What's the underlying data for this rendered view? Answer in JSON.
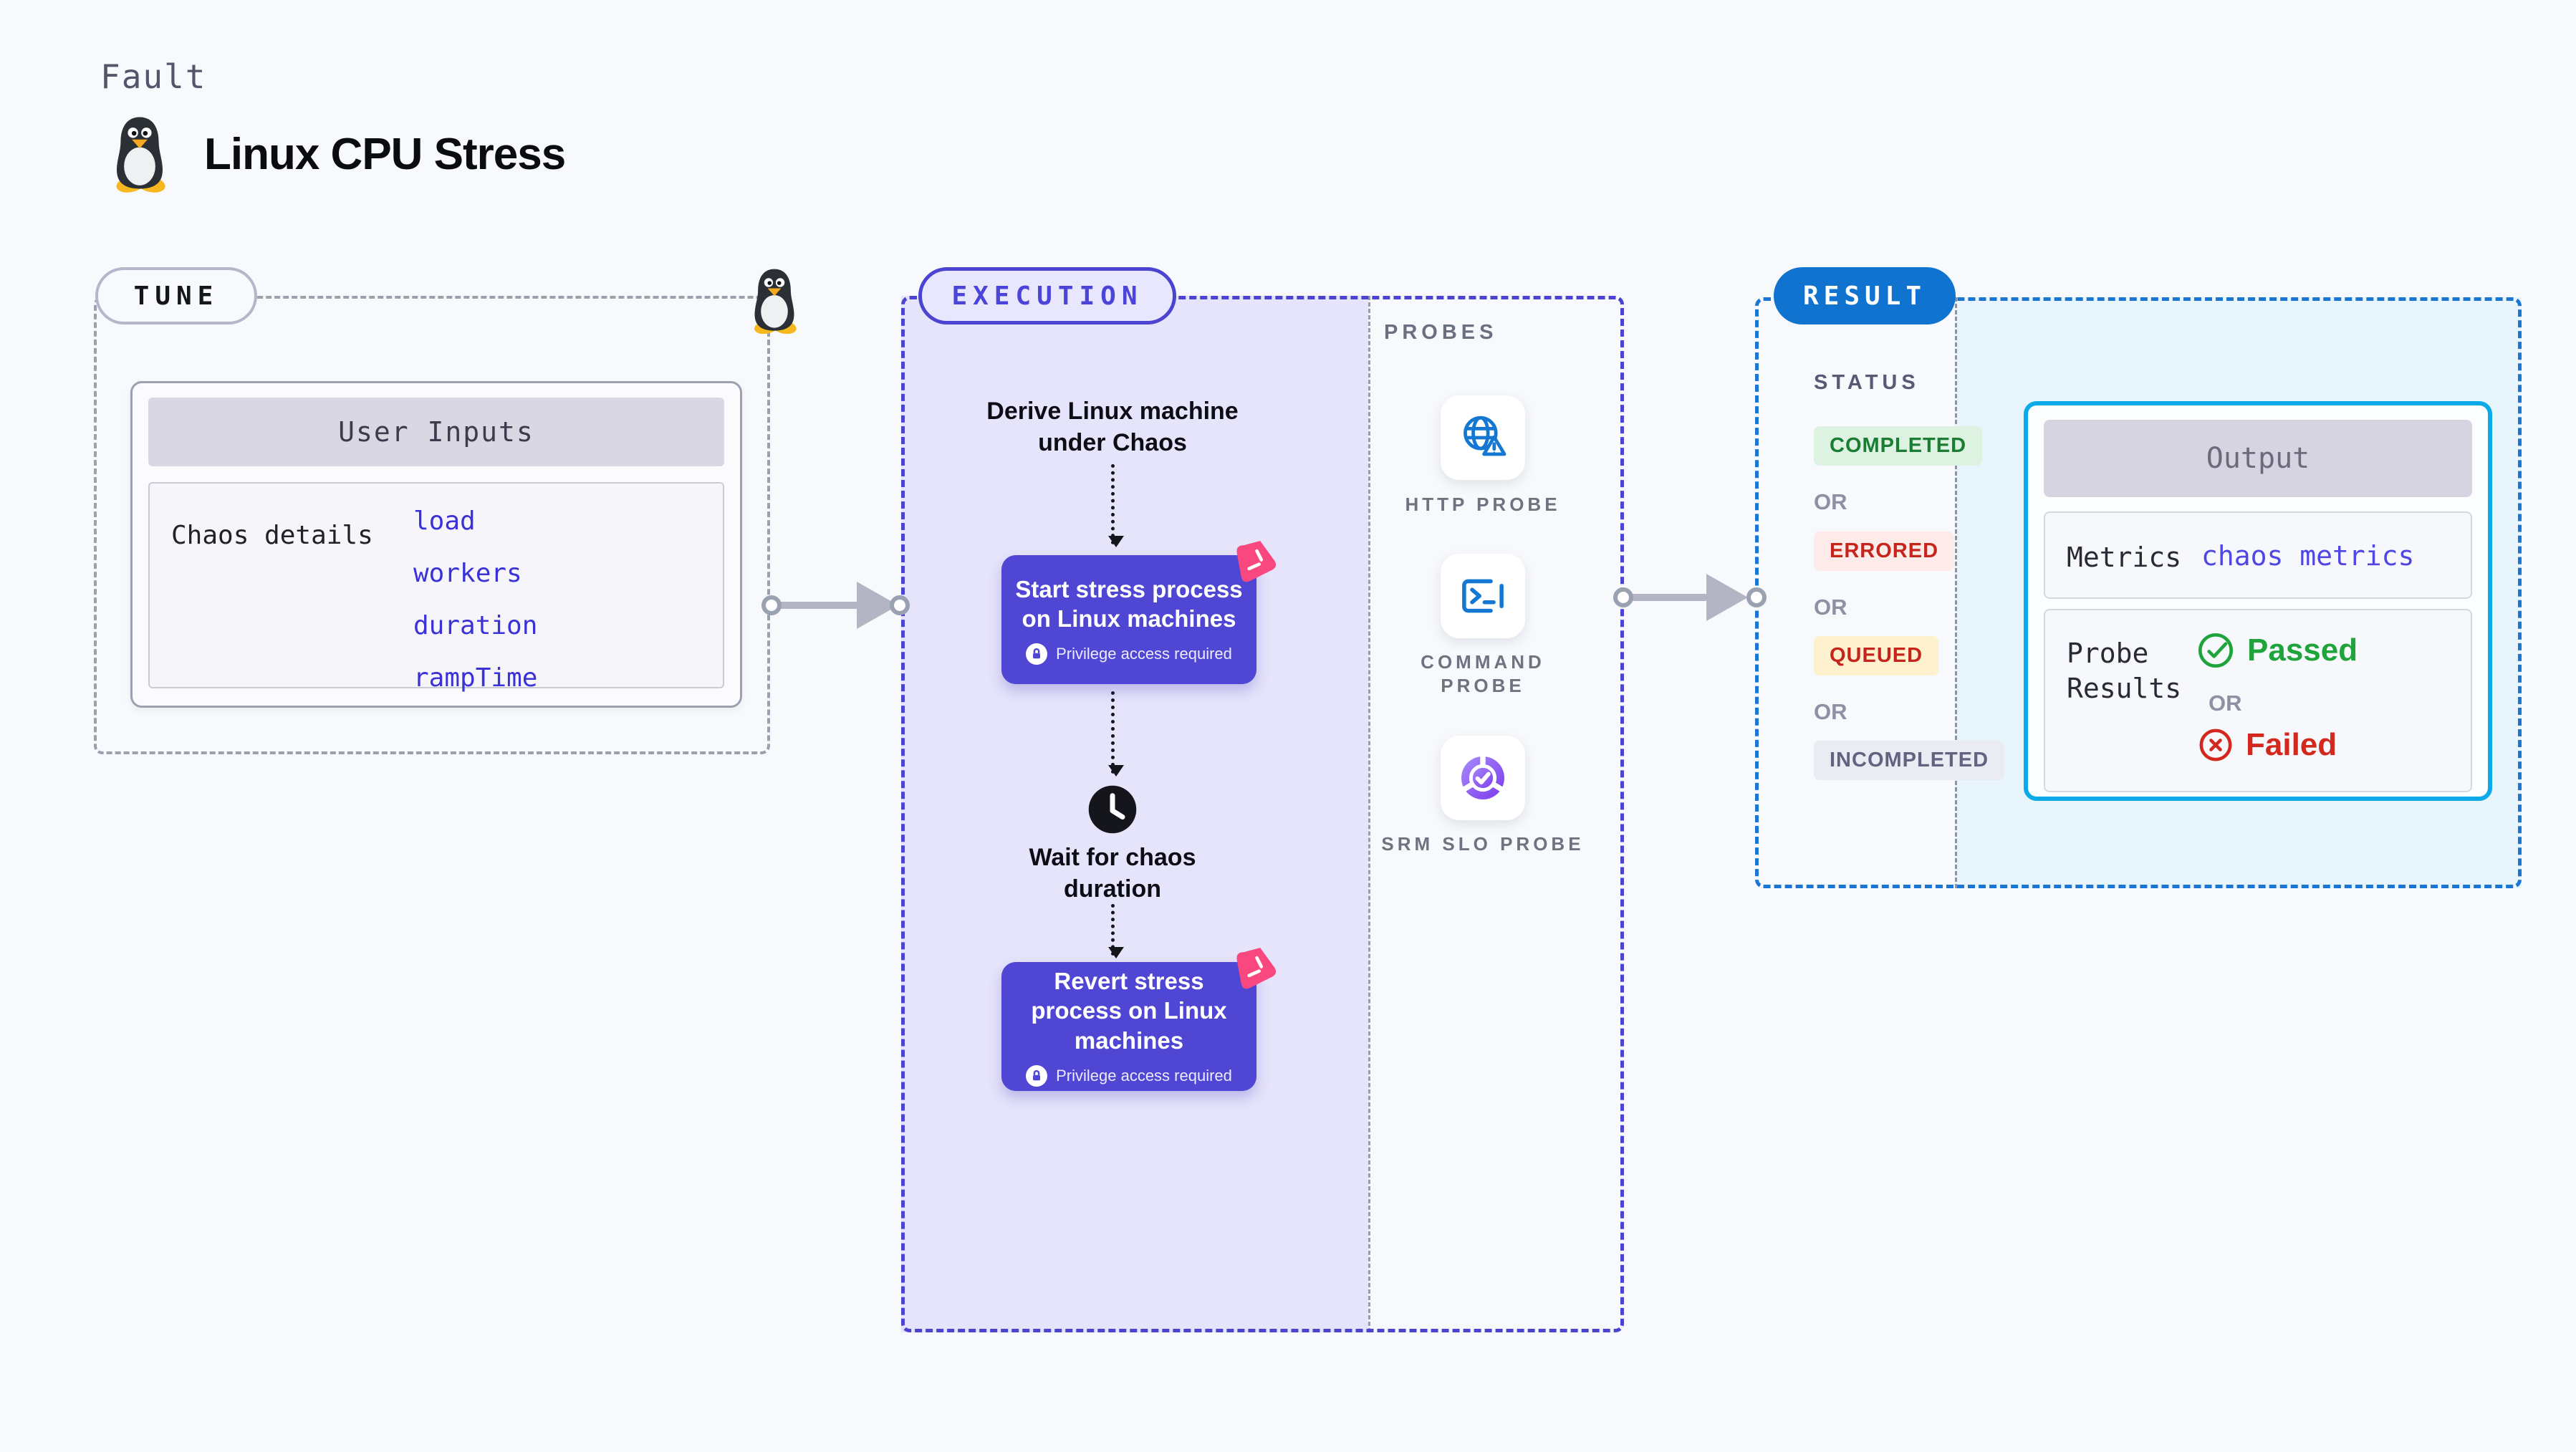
{
  "header": {
    "kicker": "Fault",
    "title": "Linux CPU Stress"
  },
  "tune": {
    "label": "TUNE",
    "card_header": "User Inputs",
    "row_label": "Chaos details",
    "inputs": [
      "load",
      "workers",
      "duration",
      "rampTime"
    ]
  },
  "execution": {
    "label": "EXECUTION",
    "derive_text": "Derive Linux machine under Chaos",
    "start_title": "Start stress process on Linux machines",
    "privilege_note": "Privilege access required",
    "wait_text": "Wait for chaos duration",
    "revert_title": "Revert stress process on Linux machines"
  },
  "probes": {
    "label": "PROBES",
    "items": [
      {
        "name": "HTTP PROBE",
        "icon": "globe-alert-icon"
      },
      {
        "name": "COMMAND PROBE",
        "icon": "terminal-icon"
      },
      {
        "name": "SRM SLO PROBE",
        "icon": "slo-donut-icon"
      }
    ]
  },
  "result": {
    "label": "RESULT",
    "status_label": "STATUS",
    "or_label": "OR",
    "statuses": [
      {
        "text": "COMPLETED",
        "type": "success"
      },
      {
        "text": "ERRORED",
        "type": "error"
      },
      {
        "text": "QUEUED",
        "type": "warning"
      },
      {
        "text": "INCOMPLETED",
        "type": "neutral"
      }
    ],
    "output": {
      "header": "Output",
      "metrics_label": "Metrics",
      "metrics_value": "chaos metrics",
      "probe_results_label": "Probe Results",
      "passed_label": "Passed",
      "failed_label": "Failed"
    }
  },
  "colors": {
    "accent_indigo": "#4b44d0",
    "node_indigo": "#4f46d3",
    "accent_blue": "#1b76d3",
    "output_border_cyan": "#0caae8",
    "link_indigo": "#3a31d8",
    "chaos_pink": "#f8487f",
    "success_green": "#1ea43b",
    "fail_red": "#d2281e"
  }
}
